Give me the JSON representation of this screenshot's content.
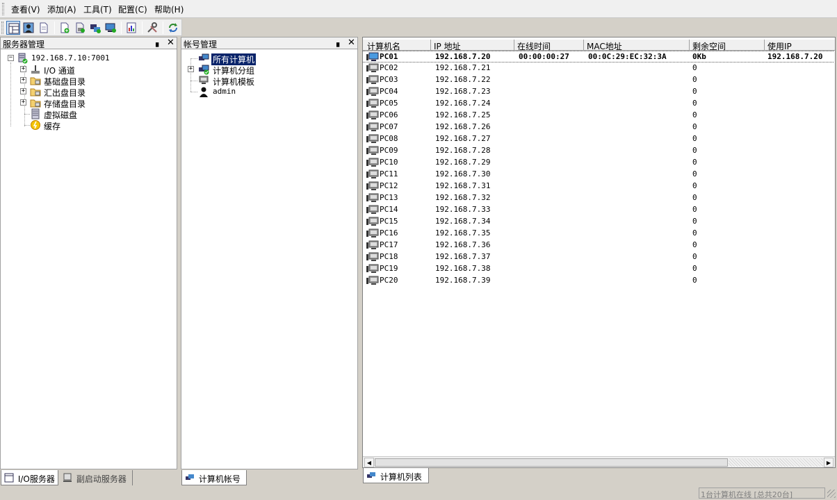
{
  "menu": [
    "查看(V)",
    "添加(A)",
    "工具(T)",
    "配置(C)",
    "帮助(H)"
  ],
  "toolbar_icons": [
    "server-view-icon",
    "user-view-icon",
    "document-icon",
    "add-server-icon",
    "add-disk-icon",
    "add-group-icon",
    "add-computer-icon",
    "report-icon",
    "tools-icon",
    "refresh-icon"
  ],
  "server_panel": {
    "title": "服务器管理",
    "root": "192.168.7.10:7001",
    "items": [
      "I/O 通道",
      "基础盘目录",
      "汇出盘目录",
      "存储盘目录",
      "虚拟磁盘",
      "缓存"
    ],
    "tabs": [
      "I/O服务器",
      "副启动服务器"
    ]
  },
  "account_panel": {
    "title": "帐号管理",
    "items": [
      "所有计算机",
      "计算机分组",
      "计算机模板",
      "admin"
    ],
    "tab": "计算机帐号"
  },
  "computer_list": {
    "columns": [
      "计算机名",
      "IP 地址",
      "在线时间",
      "MAC地址",
      "剩余空间",
      "使用IP"
    ],
    "rows": [
      {
        "name": "PC01",
        "ip": "192.168.7.20",
        "online": "00:00:00:27",
        "mac": "00:0C:29:EC:32:3A",
        "free": "0Kb",
        "used_ip": "192.168.7.20",
        "active": true
      },
      {
        "name": "PC02",
        "ip": "192.168.7.21",
        "online": "",
        "mac": "",
        "free": "0",
        "used_ip": ""
      },
      {
        "name": "PC03",
        "ip": "192.168.7.22",
        "online": "",
        "mac": "",
        "free": "0",
        "used_ip": ""
      },
      {
        "name": "PC04",
        "ip": "192.168.7.23",
        "online": "",
        "mac": "",
        "free": "0",
        "used_ip": ""
      },
      {
        "name": "PC05",
        "ip": "192.168.7.24",
        "online": "",
        "mac": "",
        "free": "0",
        "used_ip": ""
      },
      {
        "name": "PC06",
        "ip": "192.168.7.25",
        "online": "",
        "mac": "",
        "free": "0",
        "used_ip": ""
      },
      {
        "name": "PC07",
        "ip": "192.168.7.26",
        "online": "",
        "mac": "",
        "free": "0",
        "used_ip": ""
      },
      {
        "name": "PC08",
        "ip": "192.168.7.27",
        "online": "",
        "mac": "",
        "free": "0",
        "used_ip": ""
      },
      {
        "name": "PC09",
        "ip": "192.168.7.28",
        "online": "",
        "mac": "",
        "free": "0",
        "used_ip": ""
      },
      {
        "name": "PC10",
        "ip": "192.168.7.29",
        "online": "",
        "mac": "",
        "free": "0",
        "used_ip": ""
      },
      {
        "name": "PC11",
        "ip": "192.168.7.30",
        "online": "",
        "mac": "",
        "free": "0",
        "used_ip": ""
      },
      {
        "name": "PC12",
        "ip": "192.168.7.31",
        "online": "",
        "mac": "",
        "free": "0",
        "used_ip": ""
      },
      {
        "name": "PC13",
        "ip": "192.168.7.32",
        "online": "",
        "mac": "",
        "free": "0",
        "used_ip": ""
      },
      {
        "name": "PC14",
        "ip": "192.168.7.33",
        "online": "",
        "mac": "",
        "free": "0",
        "used_ip": ""
      },
      {
        "name": "PC15",
        "ip": "192.168.7.34",
        "online": "",
        "mac": "",
        "free": "0",
        "used_ip": ""
      },
      {
        "name": "PC16",
        "ip": "192.168.7.35",
        "online": "",
        "mac": "",
        "free": "0",
        "used_ip": ""
      },
      {
        "name": "PC17",
        "ip": "192.168.7.36",
        "online": "",
        "mac": "",
        "free": "0",
        "used_ip": ""
      },
      {
        "name": "PC18",
        "ip": "192.168.7.37",
        "online": "",
        "mac": "",
        "free": "0",
        "used_ip": ""
      },
      {
        "name": "PC19",
        "ip": "192.168.7.38",
        "online": "",
        "mac": "",
        "free": "0",
        "used_ip": ""
      },
      {
        "name": "PC20",
        "ip": "192.168.7.39",
        "online": "",
        "mac": "",
        "free": "0",
        "used_ip": ""
      }
    ],
    "tab": "计算机列表"
  },
  "status": "1台计算机在线 [总共20台]"
}
